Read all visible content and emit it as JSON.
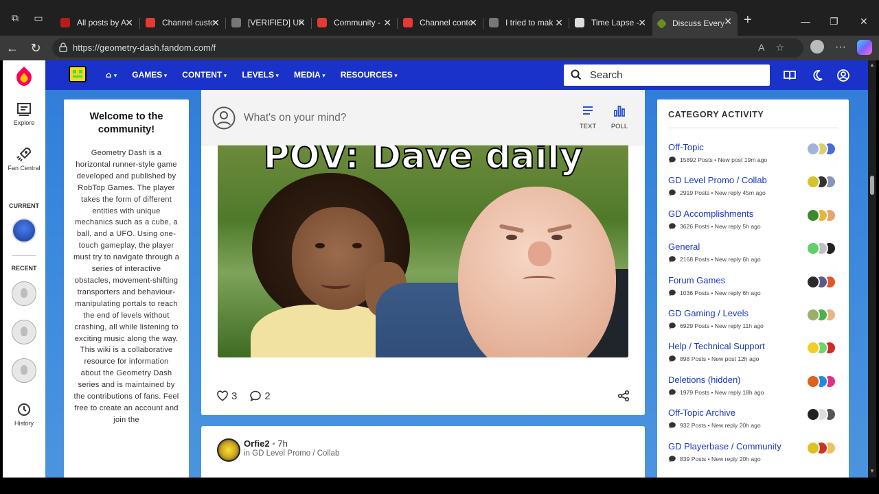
{
  "browser": {
    "tabs": [
      {
        "title": "All posts by A",
        "color": "#b71c1c"
      },
      {
        "title": "Channel custo",
        "color": "#e53935"
      },
      {
        "title": "[VERIFIED] UF",
        "color": "#888888"
      },
      {
        "title": "Community -",
        "color": "#e53935"
      },
      {
        "title": "Channel conte",
        "color": "#e53935"
      },
      {
        "title": "I tried to mak",
        "color": "#888888"
      },
      {
        "title": "Time Lapse -",
        "color": "#dddddd"
      },
      {
        "title": "Discuss Every",
        "color": "#6b8e23"
      }
    ],
    "url": "https://geometry-dash.fandom.com/f"
  },
  "rail": {
    "explore": "Explore",
    "fan_central": "Fan Central",
    "current": "CURRENT",
    "recent": "RECENT",
    "history": "History"
  },
  "header": {
    "menu": [
      "GAMES",
      "CONTENT",
      "LEVELS",
      "MEDIA",
      "RESOURCES"
    ],
    "search_placeholder": "Search"
  },
  "welcome": {
    "title": "Welcome to the community!",
    "body": "Geometry Dash is a horizontal runner-style game developed and published by RobTop Games. The player takes the form of different entities with unique mechanics such as a cube, a ball, and a UFO. Using one-touch gameplay, the player must try to navigate through a series of interactive obstacles, movement-shifting transporters and behaviour-manipulating portals to reach the end of levels without crashing, all while listening to exciting music along the way. This wiki is a collaborative resource for information about the Geometry Dash series and is maintained by the contributions of fans. Feel free to create an account and join the"
  },
  "composer": {
    "placeholder": "What's on your mind?",
    "text_label": "TEXT",
    "poll_label": "POLL"
  },
  "post": {
    "meme_caption": "POV: Dave daily",
    "likes": "3",
    "comments": "2"
  },
  "next_post": {
    "author": "Orfie2",
    "time": "7h",
    "category": "in GD Level Promo / Collab"
  },
  "category_activity": {
    "title": "CATEGORY ACTIVITY",
    "items": [
      {
        "name": "Off-Topic",
        "meta": "15892 Posts  •  New post 19m ago",
        "avatars": [
          "#9fb6d9",
          "#d8d070",
          "#4a6bd1"
        ]
      },
      {
        "name": "GD Level Promo / Collab",
        "meta": "2919 Posts  •  New reply 45m ago",
        "avatars": [
          "#d4c52a",
          "#333333",
          "#8a93b8"
        ]
      },
      {
        "name": "GD Accomplishments",
        "meta": "3626 Posts  •  New reply 5h ago",
        "avatars": [
          "#3c8a2e",
          "#e0b840",
          "#e5a46e"
        ]
      },
      {
        "name": "General",
        "meta": "2168 Posts  •  New reply 6h ago",
        "avatars": [
          "#5fd06a",
          "#bfbfbf",
          "#222222"
        ]
      },
      {
        "name": "Forum Games",
        "meta": "1036 Posts  •  New reply 6h ago",
        "avatars": [
          "#2b2b2b",
          "#5a5a8a",
          "#e0552a"
        ]
      },
      {
        "name": "GD Gaming / Levels",
        "meta": "6929 Posts  •  New reply 11h ago",
        "avatars": [
          "#9cae6a",
          "#4caf50",
          "#e8b58a"
        ]
      },
      {
        "name": "Help / Technical Support",
        "meta": "898 Posts  •  New post 12h ago",
        "avatars": [
          "#f0d028",
          "#6fd66f",
          "#d02a2a"
        ]
      },
      {
        "name": "Deletions (hidden)",
        "meta": "1979 Posts  •  New reply 18h ago",
        "avatars": [
          "#e06020",
          "#1e8ce0",
          "#e03080"
        ]
      },
      {
        "name": "Off-Topic Archive",
        "meta": "932 Posts  •  New reply 20h ago",
        "avatars": [
          "#222222",
          "#dddddd",
          "#555555"
        ]
      },
      {
        "name": "GD Playerbase / Community",
        "meta": "839 Posts  •  New reply 20h ago",
        "avatars": [
          "#e0c020",
          "#d03020",
          "#f0c060"
        ]
      }
    ]
  }
}
